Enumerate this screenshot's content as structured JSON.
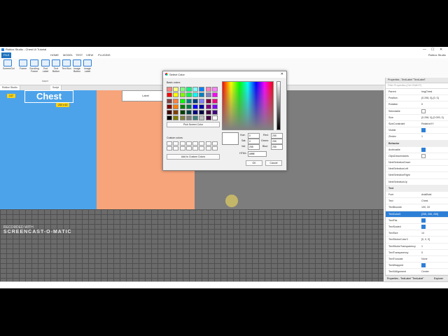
{
  "window": {
    "title": "Roblox Studio - Chest UI Tutorial",
    "controls": [
      "—",
      "☐",
      "✕"
    ]
  },
  "menu": {
    "file": "FILE",
    "items": [
      "HOME",
      "MODEL",
      "TEST",
      "VIEW",
      "PLUGINS"
    ],
    "user": "Roblox Studio"
  },
  "ribbon": {
    "buttons": [
      "ScreenGui",
      "Frame",
      "Scrolling Frame",
      "Text Label",
      "Text Button",
      "Text Box",
      "Image Button",
      "Image Label"
    ],
    "group_label": "Insert"
  },
  "tabs": [
    "Roblox Studio",
    "Script"
  ],
  "viewport": {
    "chest_text": "Chest",
    "label_button": "Label",
    "left_tag": "147",
    "size_tag": "250 x 60",
    "ui_label": "UI Edit"
  },
  "properties": {
    "header": "Properties - TextLabel \"TextLabel\"",
    "filter": "Filter Properties (Ctrl+Shift+P)",
    "footer_tab": "Properties - TextLabel \"TextLabel\"",
    "footer_right": "Explorer",
    "rows": [
      {
        "k": "Parent",
        "v": "ImgChest",
        "type": "text"
      },
      {
        "k": "Position",
        "v": "{0.298, 0},{0, 0}",
        "type": "text"
      },
      {
        "k": "Rotation",
        "v": "0",
        "type": "text"
      },
      {
        "k": "Selectable",
        "v": "",
        "type": "check"
      },
      {
        "k": "Size",
        "v": "{0.298, 0},{0.093, 0}",
        "type": "text"
      },
      {
        "k": "SizeConstraint",
        "v": "RelativeXY",
        "type": "text"
      },
      {
        "k": "Visible",
        "v": "",
        "type": "checkon"
      },
      {
        "k": "ZIndex",
        "v": "1",
        "type": "text"
      },
      {
        "k": "Behavior",
        "v": "",
        "type": "section"
      },
      {
        "k": "Archivable",
        "v": "",
        "type": "checkon"
      },
      {
        "k": "ClipsDescendants",
        "v": "",
        "type": "check"
      },
      {
        "k": "NextSelectionDown",
        "v": "",
        "type": "text"
      },
      {
        "k": "NextSelectionLeft",
        "v": "",
        "type": "text"
      },
      {
        "k": "NextSelectionRight",
        "v": "",
        "type": "text"
      },
      {
        "k": "NextSelectionUp",
        "v": "",
        "type": "text"
      },
      {
        "k": "Text",
        "v": "",
        "type": "section"
      },
      {
        "k": "Font",
        "v": "ArialBold",
        "type": "text"
      },
      {
        "k": "Text",
        "v": "Chest",
        "type": "text"
      },
      {
        "k": "TextBounds",
        "v": "100, 33",
        "type": "text"
      },
      {
        "k": "TextColor3",
        "v": "[255, 255, 255]",
        "type": "selected"
      },
      {
        "k": "TextFits",
        "v": "",
        "type": "checkon"
      },
      {
        "k": "TextScaled",
        "v": "",
        "type": "checkon"
      },
      {
        "k": "TextSize",
        "v": "14",
        "type": "text"
      },
      {
        "k": "TextStrokeColor3",
        "v": "[0, 0, 0]",
        "type": "text"
      },
      {
        "k": "TextStrokeTransparency",
        "v": "1",
        "type": "text"
      },
      {
        "k": "TextTransparency",
        "v": "0",
        "type": "text"
      },
      {
        "k": "TextTruncate",
        "v": "None",
        "type": "text"
      },
      {
        "k": "TextWrapped",
        "v": "",
        "type": "checkon"
      },
      {
        "k": "TextXAlignment",
        "v": "Center",
        "type": "text"
      },
      {
        "k": "TextYAlignment",
        "v": "Center",
        "type": "text"
      },
      {
        "k": "Localization",
        "v": "",
        "type": "section"
      }
    ]
  },
  "dialog": {
    "title": "Select Color",
    "close": "✕",
    "basic_colors_label": "Basic colors",
    "pick_screen_label": "Pick Screen Color",
    "custom_colors_label": "Custom colors",
    "add_custom_label": "Add to Custom Colors",
    "hue_label": "Hue:",
    "hue": "0",
    "sat_label": "Sat:",
    "sat": "0",
    "val_label": "Val:",
    "val": "255",
    "red_label": "Red:",
    "red": "255",
    "green_label": "Green:",
    "green": "255",
    "blue_label": "Blue:",
    "blue": "255",
    "html_label": "HTML:",
    "html": "#ffffff",
    "ok_label": "OK",
    "cancel_label": "Cancel",
    "basic_colors": [
      "#ff8080",
      "#ffff80",
      "#80ff80",
      "#00ff80",
      "#80ffff",
      "#0080ff",
      "#ff80c0",
      "#ff80ff",
      "#ff0000",
      "#ffff00",
      "#80ff00",
      "#00ff40",
      "#00ffff",
      "#0080c0",
      "#8080c0",
      "#ff00ff",
      "#804040",
      "#ff8040",
      "#00ff00",
      "#008080",
      "#004080",
      "#8080ff",
      "#800040",
      "#ff0080",
      "#800000",
      "#ff8000",
      "#008000",
      "#008040",
      "#0000ff",
      "#0000a0",
      "#800080",
      "#8000ff",
      "#400000",
      "#804000",
      "#004000",
      "#004040",
      "#000080",
      "#000040",
      "#400040",
      "#400080",
      "#000000",
      "#808000",
      "#808040",
      "#808080",
      "#408080",
      "#c0c0c0",
      "#400040",
      "#ffffff"
    ]
  },
  "watermark": {
    "line1": "RECORDED WITH",
    "line2": "SCREENCAST-O-MATIC"
  }
}
